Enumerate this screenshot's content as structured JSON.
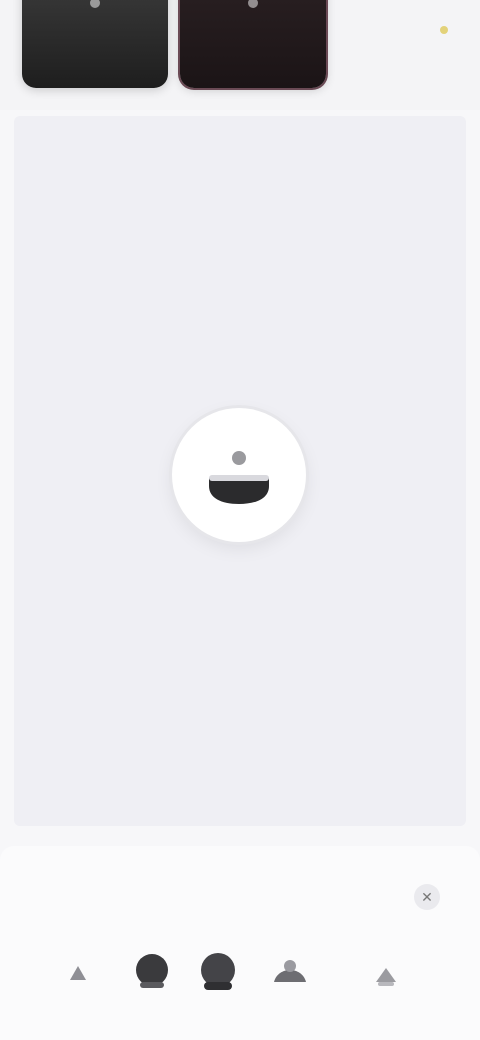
{
  "top_strip": {
    "thumbnails": [
      {
        "name": "template-1"
      },
      {
        "name": "template-2"
      }
    ],
    "label": ""
  },
  "canvas": {
    "center_button": {
      "icon": "user-add-icon"
    }
  },
  "bottom_sheet": {
    "title": "",
    "close_icon": "close-icon",
    "tools": [
      {
        "icon": "tool-a-icon"
      },
      {
        "icon": "tool-b-icon"
      },
      {
        "icon": "tool-c-icon"
      },
      {
        "icon": "tool-d-icon"
      },
      {
        "icon": "tool-e-icon"
      }
    ]
  },
  "colors": {
    "background": "#f7f7f9",
    "canvas": "#efeff4",
    "accent_dot": "#e3d27a"
  }
}
